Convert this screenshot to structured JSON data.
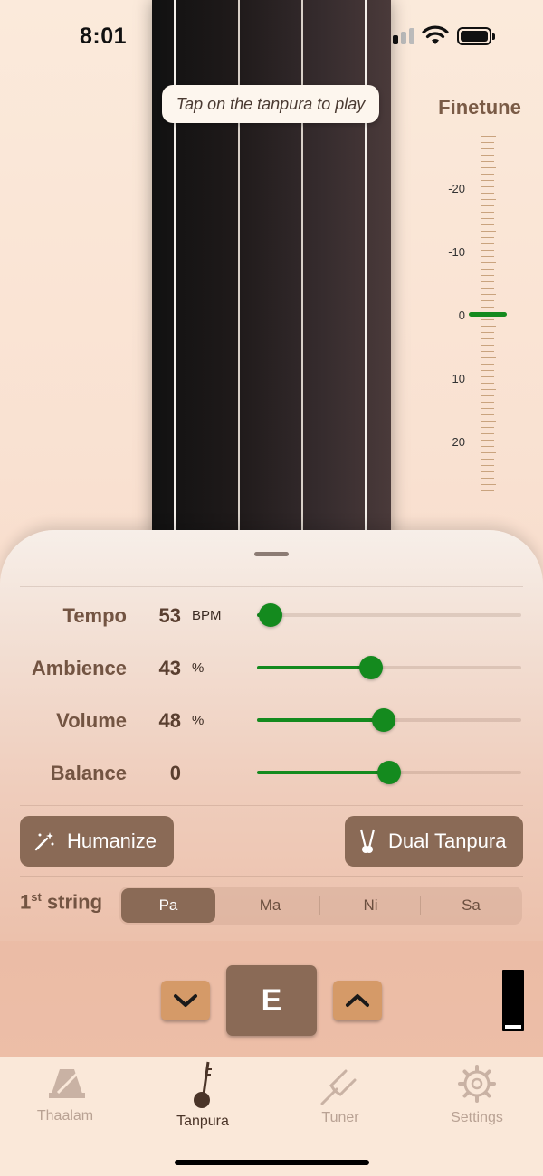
{
  "status_bar": {
    "time": "8:01"
  },
  "tanpura": {
    "hint": "Tap on the tanpura to play"
  },
  "finetune": {
    "title": "Finetune",
    "labels": [
      "-20",
      "-10",
      "0",
      "10",
      "20"
    ],
    "value": 0,
    "marker_color": "#148a1e"
  },
  "controls": {
    "tempo": {
      "label": "Tempo",
      "value": "53",
      "unit": "BPM",
      "fraction": 0.05
    },
    "ambience": {
      "label": "Ambience",
      "value": "43",
      "unit": "%",
      "fraction": 0.43
    },
    "volume": {
      "label": "Volume",
      "value": "48",
      "unit": "%",
      "fraction": 0.48
    },
    "balance": {
      "label": "Balance",
      "value": "0",
      "unit": "",
      "fraction": 0.5
    }
  },
  "buttons": {
    "humanize": "Humanize",
    "dual_tanpura": "Dual Tanpura"
  },
  "first_string": {
    "label_main": "1",
    "label_sup": "st",
    "label_rest": " string",
    "options": [
      "Pa",
      "Ma",
      "Ni",
      "Sa"
    ],
    "selected": "Pa"
  },
  "key": {
    "value": "E"
  },
  "tabs": [
    {
      "label": "Thaalam",
      "icon": "metronome-icon",
      "active": false
    },
    {
      "label": "Tanpura",
      "icon": "tanpura-icon",
      "active": true
    },
    {
      "label": "Tuner",
      "icon": "tuning-fork-icon",
      "active": false
    },
    {
      "label": "Settings",
      "icon": "gear-icon",
      "active": false
    }
  ],
  "colors": {
    "accent": "#148a1e",
    "brown": "#8a6a56",
    "orange_button": "#d59a68"
  }
}
